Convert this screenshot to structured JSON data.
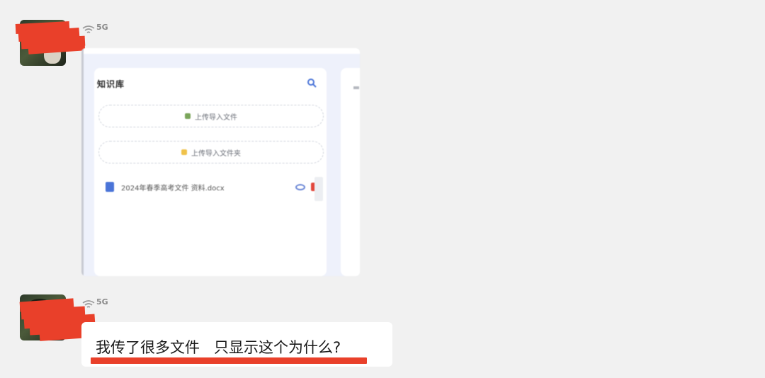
{
  "messages": [
    {
      "network_label": "5G",
      "type": "image",
      "screenshot": {
        "panel_title": "知识库",
        "buttons": [
          {
            "label": "上传导入文件",
            "icon_color": "#7aa55a"
          },
          {
            "label": "上传导入文件夹",
            "icon_color": "#f0c24a"
          }
        ],
        "files": [
          {
            "name": "2024年春季高考文件 资料.docx"
          }
        ]
      }
    },
    {
      "network_label": "5G",
      "type": "text",
      "text": "我传了很多文件   只显示这个为什么?"
    }
  ],
  "colors": {
    "background": "#f1f1f1",
    "redaction": "#e9402a",
    "bubble": "#ffffff",
    "panel_bg": "#eef1fb"
  }
}
